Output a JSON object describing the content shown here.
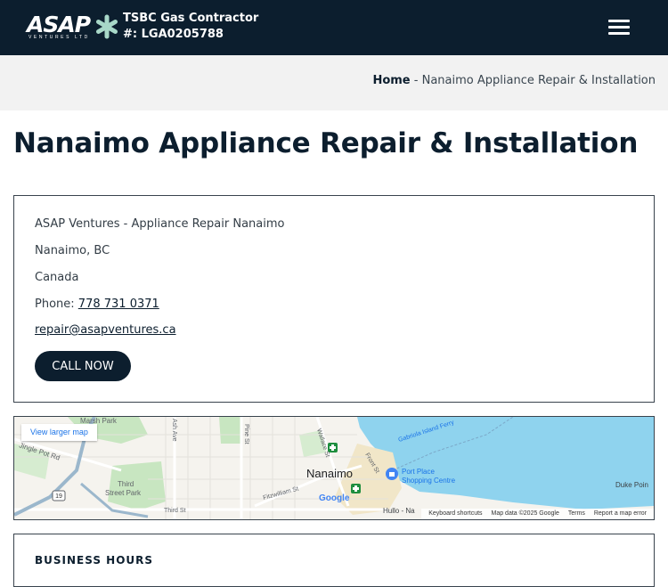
{
  "header": {
    "logo_text": "ASAP",
    "logo_subtext": "VENTURES LTD",
    "contractor_line1": "TSBC Gas Contractor",
    "contractor_line2": "#: LGA0205788",
    "menu_icon": "hamburger-menu-icon"
  },
  "breadcrumb": {
    "home": "Home",
    "separator": " - ",
    "current": "Nanaimo Appliance Repair & Installation"
  },
  "page": {
    "title": "Nanaimo Appliance Repair & Installation"
  },
  "contact": {
    "business_name": "ASAP Ventures - Appliance Repair Nanaimo",
    "city": "Nanaimo, BC",
    "country": "Canada",
    "phone_label": "Phone: ",
    "phone": "778 731 0371",
    "email": "repair@asapventures.ca",
    "call_button": "CALL NOW"
  },
  "map": {
    "view_larger": "View larger map",
    "labels": {
      "marsh_park": "Marsh Park",
      "jingle_pot": "Jingle Pot Rd",
      "third_street_park_1": "Third",
      "third_street_park_2": "Street Park",
      "route": "19",
      "third_st": "Third St",
      "pine_st": "Pine St",
      "ash_ave": "Ash Ave",
      "wallace_st": "Wallace St",
      "fitzwilliam": "Fitzwilliam St",
      "nanaimo": "Nanaimo",
      "front_st": "Front St",
      "gabriola_ferry": "Gabriola Island Ferry",
      "port_place_1": "Port Place",
      "port_place_2": "Shopping Centre",
      "duke_point": "Duke Poin",
      "hullo": "Hullo - Na",
      "google": "Google"
    },
    "footer": {
      "shortcuts": "Keyboard shortcuts",
      "data": "Map data ©2025 Google",
      "terms": "Terms",
      "report": "Report a map error"
    },
    "colors": {
      "water": "#8fd3ee",
      "land": "#f5f3ee",
      "park": "#c8e6c1",
      "road": "#ffffff",
      "highway": "#9bb7cc"
    }
  },
  "hours": {
    "title": "BUSINESS HOURS"
  },
  "colors": {
    "brand_navy": "#0c1e2e",
    "logo_accent": "#a8d8c8",
    "breadcrumb_bg": "#f2f2f2"
  }
}
